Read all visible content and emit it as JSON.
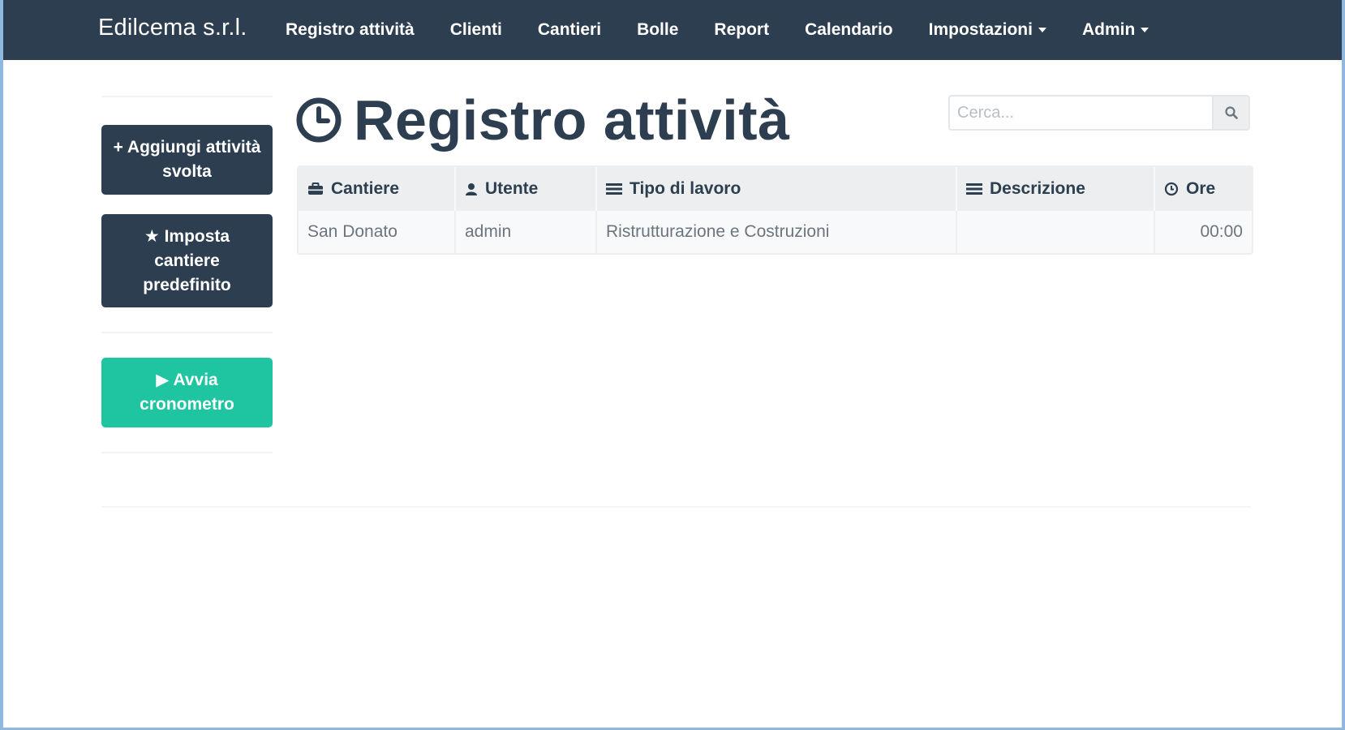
{
  "navbar": {
    "brand": "Edilcema s.r.l.",
    "items": [
      {
        "label": "Registro attività",
        "dropdown": false
      },
      {
        "label": "Clienti",
        "dropdown": false
      },
      {
        "label": "Cantieri",
        "dropdown": false
      },
      {
        "label": "Bolle",
        "dropdown": false
      },
      {
        "label": "Report",
        "dropdown": false
      },
      {
        "label": "Calendario",
        "dropdown": false
      },
      {
        "label": "Impostazioni",
        "dropdown": true
      },
      {
        "label": "Admin",
        "dropdown": true
      }
    ]
  },
  "sidebar": {
    "add_activity": "+ Aggiungi attività svolta",
    "set_default_site": "★ Imposta cantiere predefinito",
    "start_timer": "▶ Avvia cronometro"
  },
  "main": {
    "title": "Registro attività",
    "search_placeholder": "Cerca..."
  },
  "table": {
    "headers": {
      "cantiere": "Cantiere",
      "utente": "Utente",
      "tipo": "Tipo di lavoro",
      "descrizione": "Descrizione",
      "ore": "Ore"
    },
    "rows": [
      {
        "cantiere": "San Donato",
        "utente": "admin",
        "tipo": "Ristrutturazione e Costruzioni",
        "descrizione": "",
        "ore": "00:00"
      }
    ]
  },
  "colors": {
    "navbar": "#2c3e50",
    "primary_button": "#2c3e50",
    "success_button": "#1fc5a0",
    "table_header": "#eceeef"
  },
  "icons": {
    "title": "clock-icon",
    "search": "search-icon",
    "cantiere": "briefcase-icon",
    "utente": "user-icon",
    "tipo": "list-icon",
    "descrizione": "list-icon",
    "ore": "clock-icon"
  }
}
